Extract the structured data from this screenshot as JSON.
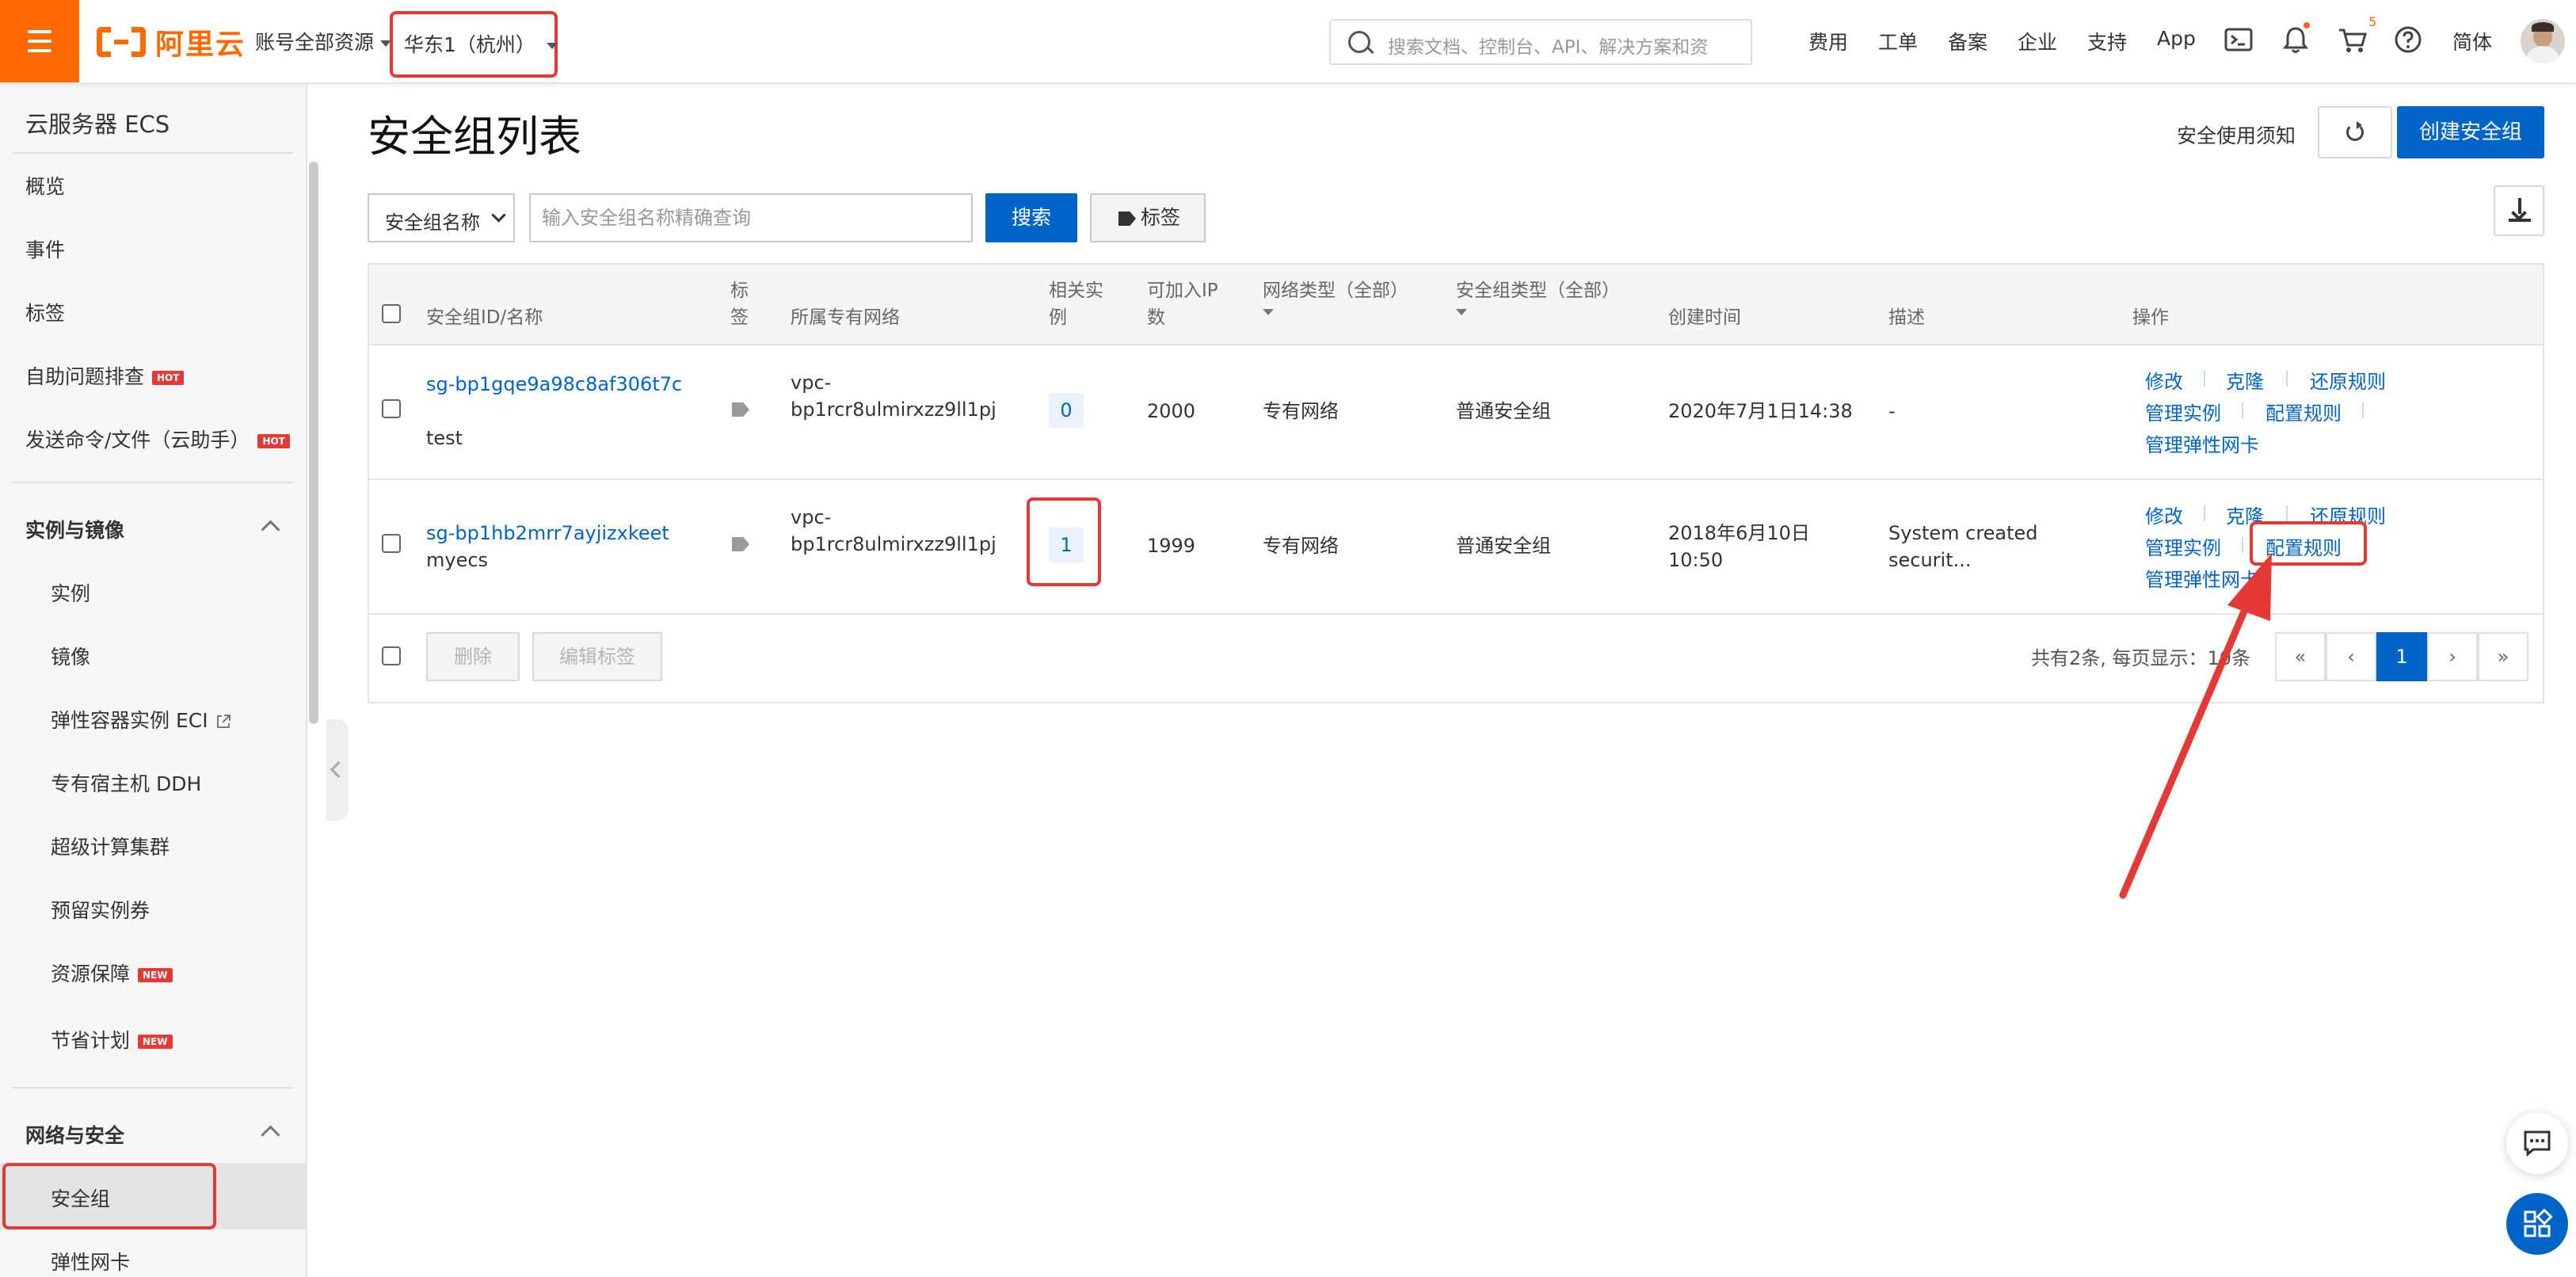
{
  "topbar": {
    "logo_text": "阿里云",
    "account_resources": "账号全部资源",
    "region": "华东1（杭州）",
    "search_placeholder": "搜索文档、控制台、API、解决方案和资",
    "nav": [
      "费用",
      "工单",
      "备案",
      "企业",
      "支持",
      "App"
    ],
    "cart_count": "5",
    "language": "简体",
    "icons": [
      "menu-icon",
      "search-icon",
      "terminal-icon",
      "bell-icon",
      "cart-icon",
      "help-icon",
      "avatar"
    ]
  },
  "sidebar": {
    "title": "云服务器 ECS",
    "items": [
      {
        "label": "概览"
      },
      {
        "label": "事件"
      },
      {
        "label": "标签"
      },
      {
        "label": "自助问题排查",
        "badge": "HOT"
      },
      {
        "label": "发送命令/文件（云助手）",
        "badge": "HOT"
      }
    ],
    "group_instances": {
      "label": "实例与镜像",
      "items": [
        {
          "label": "实例"
        },
        {
          "label": "镜像"
        },
        {
          "label": "弹性容器实例 ECI"
        },
        {
          "label": "专有宿主机 DDH"
        },
        {
          "label": "超级计算集群"
        },
        {
          "label": "预留实例券"
        },
        {
          "label": "资源保障",
          "badge": "NEW"
        },
        {
          "label": "节省计划",
          "badge": "NEW"
        }
      ]
    },
    "group_network": {
      "label": "网络与安全",
      "items": [
        {
          "label": "安全组",
          "active": true
        },
        {
          "label": "弹性网卡"
        }
      ]
    }
  },
  "main": {
    "title": "安全组列表",
    "notice_link": "安全使用须知",
    "create_button": "创建安全组",
    "filter": {
      "select_value": "安全组名称",
      "input_placeholder": "输入安全组名称精确查询",
      "search_button": "搜索",
      "tag_button": "标签"
    },
    "table": {
      "headers": {
        "id_name": "安全组ID/名称",
        "tag": "标签",
        "vpc": "所属专有网络",
        "instances": "相关实例",
        "ip_count": "可加入IP数",
        "network_type": "网络类型（全部）",
        "sg_type": "安全组类型（全部）",
        "created": "创建时间",
        "desc": "描述",
        "ops": "操作"
      },
      "rows": [
        {
          "id": "sg-bp1gqe9a98c8af306t7c",
          "name": "test",
          "vpc_line1": "vpc-",
          "vpc_line2": "bp1rcr8ulmirxzz9ll1pj",
          "instances": "0",
          "ip_count": "2000",
          "network_type": "专有网络",
          "sg_type": "普通安全组",
          "created_line1": "2020年7月1日14:38",
          "created_line2": "",
          "desc_line1": "-",
          "desc_line2": "",
          "ops": {
            "modify": "修改",
            "clone": "克隆",
            "restore": "还原规则",
            "manage": "管理实例",
            "config": "配置规则",
            "eni": "管理弹性网卡"
          }
        },
        {
          "id": "sg-bp1hb2mrr7ayjizxkeet",
          "name": "myecs",
          "vpc_line1": "vpc-",
          "vpc_line2": "bp1rcr8ulmirxzz9ll1pj",
          "instances": "1",
          "ip_count": "1999",
          "network_type": "专有网络",
          "sg_type": "普通安全组",
          "created_line1": "2018年6月10日",
          "created_line2": "10:50",
          "desc_line1": "System created",
          "desc_line2": "securit...",
          "ops": {
            "modify": "修改",
            "clone": "克隆",
            "restore": "还原规则",
            "manage": "管理实例",
            "config": "配置规则",
            "eni": "管理弹性网卡"
          }
        }
      ]
    },
    "footer": {
      "delete_button": "删除",
      "edit_tag_button": "编辑标签",
      "summary": "共有2条, 每页显示：10条",
      "pager": {
        "first": "«",
        "prev": "‹",
        "current": "1",
        "next": "›",
        "last": "»"
      }
    }
  },
  "colors": {
    "brand_orange": "#ff6a00",
    "primary_blue": "#0064c8",
    "annotation_red": "#e53935"
  }
}
